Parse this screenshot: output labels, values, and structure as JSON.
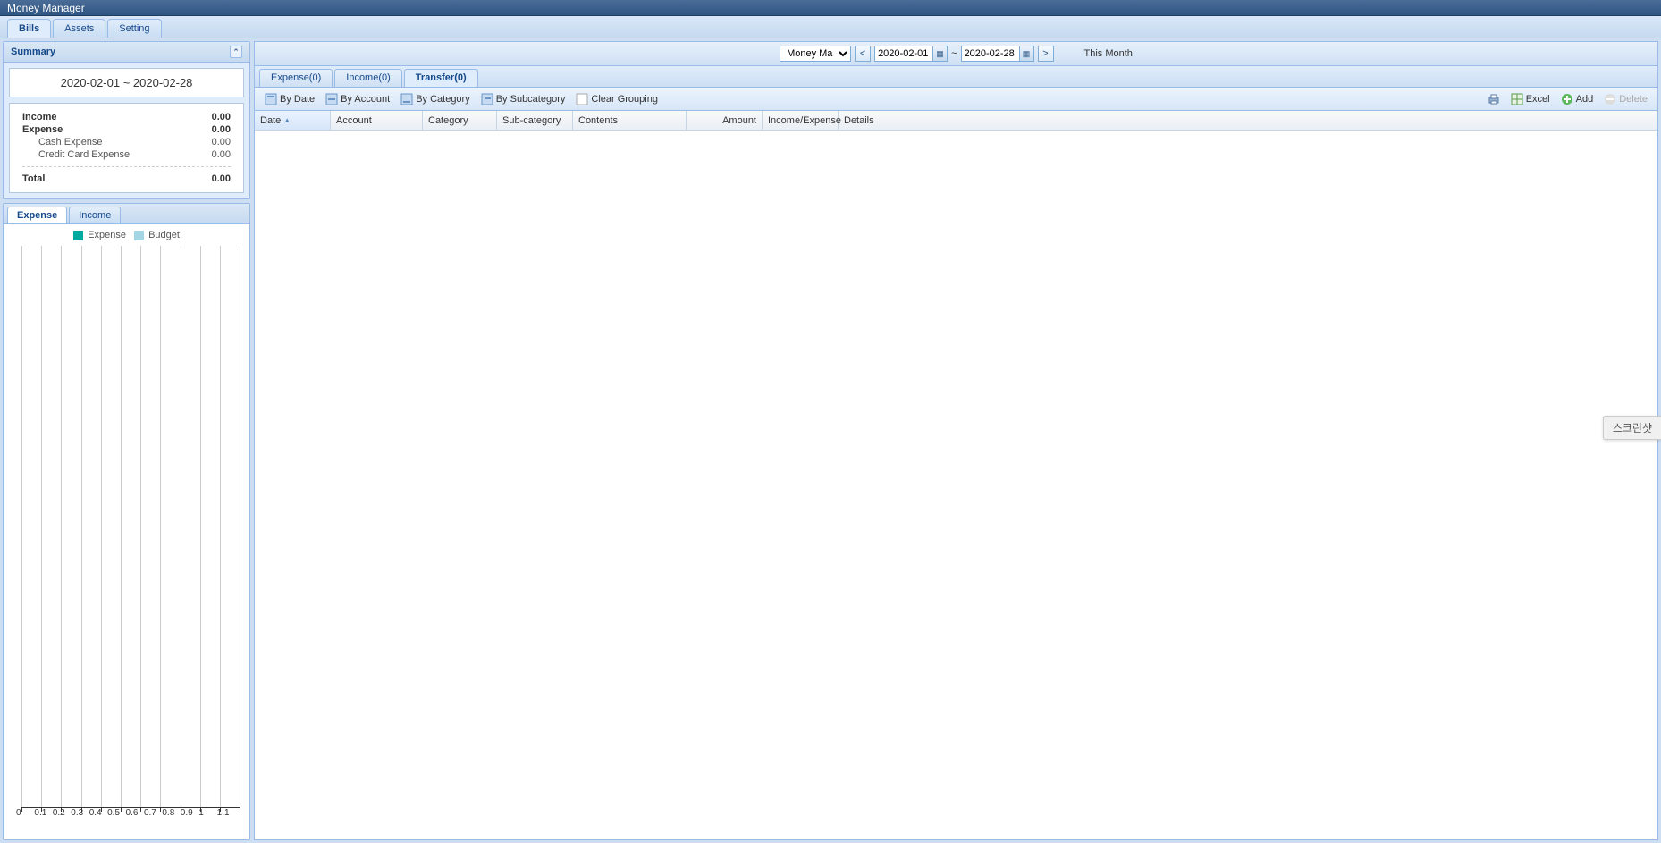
{
  "app_title": "Money Manager",
  "main_tabs": {
    "bills": "Bills",
    "assets": "Assets",
    "setting": "Setting"
  },
  "summary": {
    "header": "Summary",
    "date_range": "2020-02-01  ~  2020-02-28",
    "rows": {
      "income_label": "Income",
      "income_value": "0.00",
      "expense_label": "Expense",
      "expense_value": "0.00",
      "cash_label": "Cash Expense",
      "cash_value": "0.00",
      "credit_label": "Credit Card Expense",
      "credit_value": "0.00",
      "total_label": "Total",
      "total_value": "0.00"
    }
  },
  "chart_tabs": {
    "expense": "Expense",
    "income": "Income"
  },
  "legend": {
    "expense": "Expense",
    "budget": "Budget"
  },
  "colors": {
    "expense_swatch": "#00a9a0",
    "budget_swatch": "#a3d5e4"
  },
  "chart_data": {
    "type": "bar",
    "categories": [],
    "series": [
      {
        "name": "Expense",
        "values": []
      },
      {
        "name": "Budget",
        "values": []
      }
    ],
    "xticks": [
      "0",
      "0.1",
      "0.2",
      "0.3",
      "0.4",
      "0.5",
      "0.6",
      "0.7",
      "0.8",
      "0.9",
      "1",
      "1.1"
    ],
    "title": "",
    "xlabel": "",
    "ylabel": ""
  },
  "top_toolbar": {
    "account_select": "Money Manager",
    "date_from": "2020-02-01",
    "date_to": "2020-02-28",
    "tilde": "~",
    "prev": "<",
    "next": ">",
    "this_month": "This Month"
  },
  "sub_tabs": {
    "expense": "Expense(0)",
    "income": "Income(0)",
    "transfer": "Transfer(0)"
  },
  "toolbar": {
    "by_date": "By Date",
    "by_account": "By Account",
    "by_category": "By Category",
    "by_subcategory": "By Subcategory",
    "clear_grouping": "Clear Grouping",
    "excel": "Excel",
    "add": "Add",
    "delete": "Delete"
  },
  "grid_columns": {
    "date": "Date",
    "account": "Account",
    "category": "Category",
    "subcategory": "Sub-category",
    "contents": "Contents",
    "amount": "Amount",
    "income_expense": "Income/Expense",
    "details": "Details"
  },
  "floating": "스크린샷"
}
